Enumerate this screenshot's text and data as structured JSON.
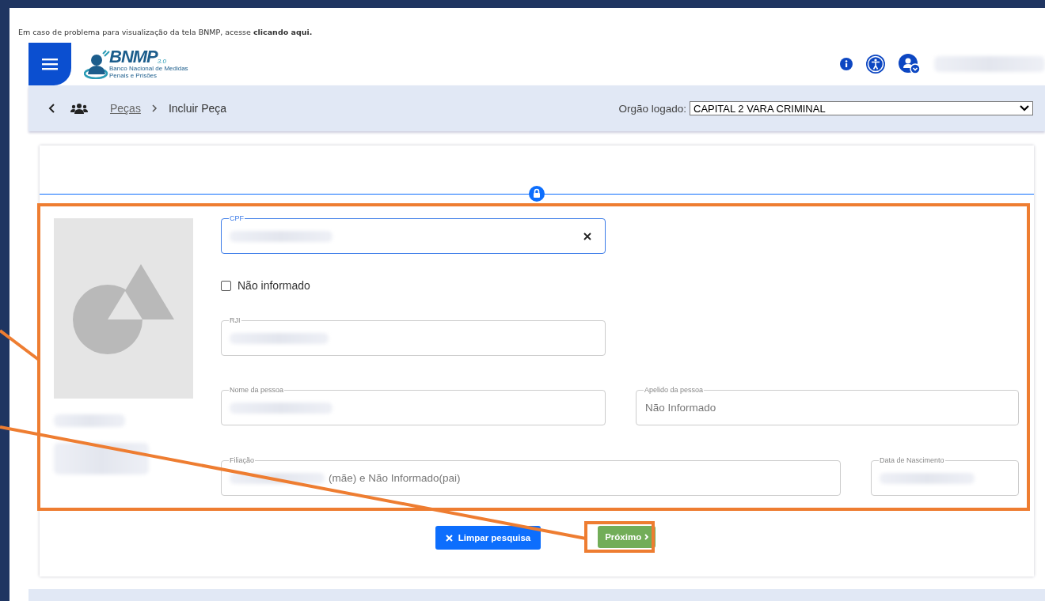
{
  "notice": {
    "text": "Em caso de problema para visualização da tela BNMP, acesse ",
    "link": "clicando aqui."
  },
  "logo": {
    "name": "BNMP",
    "version": "3.0",
    "tagline": "Banco Nacional de Medidas Penais e Prisões"
  },
  "breadcrumb": [
    {
      "label": "Peças",
      "link": true
    },
    {
      "label": "Incluir Peça",
      "link": false
    }
  ],
  "organ": {
    "label": "Orgão logado:",
    "value": "CAPITAL 2 VARA CRIMINAL"
  },
  "form": {
    "cpf": {
      "label": "CPF",
      "focused": true
    },
    "not_informed": {
      "label": "Não informado",
      "checked": false
    },
    "rji": {
      "label": "RJI"
    },
    "name": {
      "label": "Nome da pessoa"
    },
    "nickname": {
      "label": "Apelido da pessoa",
      "value": "Não Informado"
    },
    "filiation": {
      "label": "Filiação",
      "value": "(mãe) e Não Informado(pai)"
    },
    "birth": {
      "label": "Data de Nascimento"
    }
  },
  "buttons": [
    {
      "kind": "clear",
      "label": "Limpar pesquisa"
    },
    {
      "kind": "next",
      "label": "Próximo"
    }
  ]
}
